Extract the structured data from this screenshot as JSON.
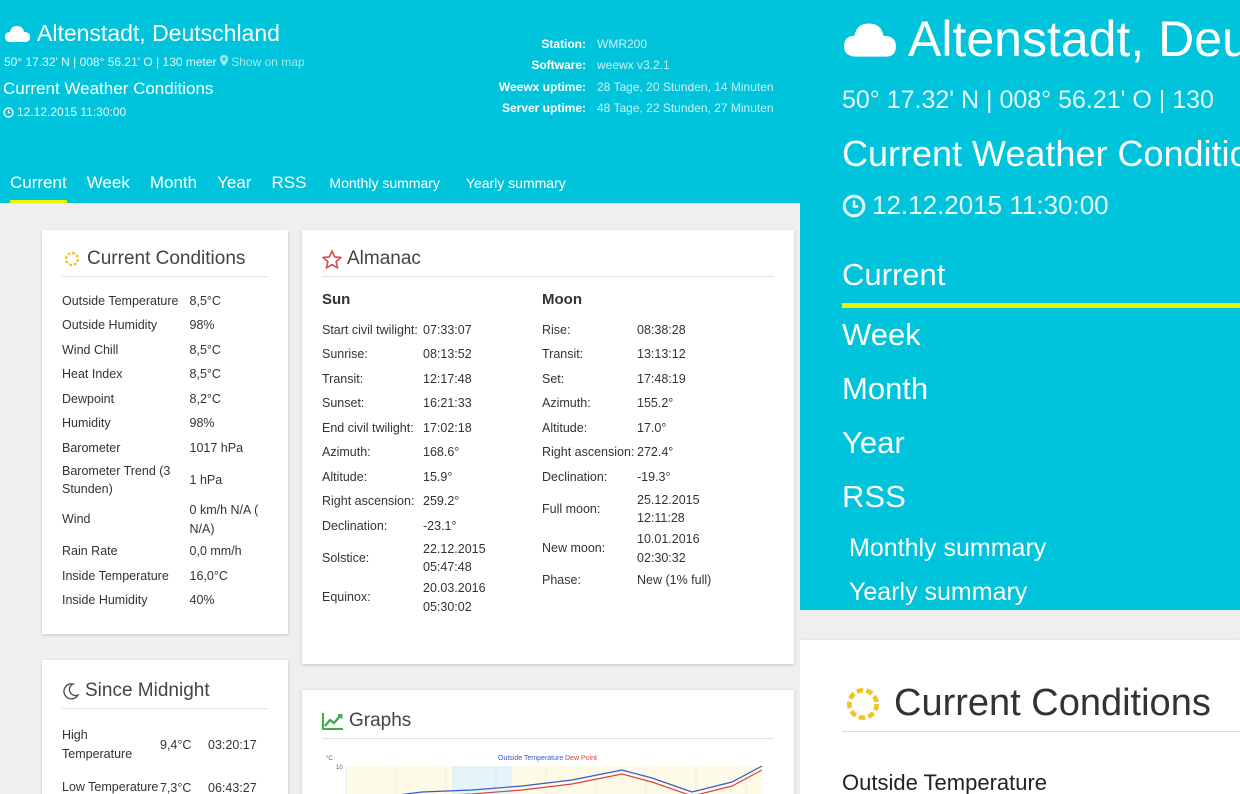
{
  "header": {
    "location": "Altenstadt, Deutschland",
    "coords": "50° 17.32' N | 008° 56.21' O | 130 meter",
    "coords_mobile": "50° 17.32' N | 008° 56.21' O | 130",
    "map_link": "Show on map",
    "subtitle": "Current Weather Conditions",
    "timestamp": "12.12.2015 11:30:00",
    "icons": {
      "cloud": "cloud-icon",
      "map": "map-marker-icon",
      "clock": "clock-icon"
    },
    "station": [
      {
        "label": "Station:",
        "value": "WMR200"
      },
      {
        "label": "Software:",
        "value": "weewx v3.2.1"
      },
      {
        "label": "Weewx uptime:",
        "value": "28 Tage, 20 Stunden, 14 Minuten"
      },
      {
        "label": "Server uptime:",
        "value": "48 Tage, 22 Stunden, 27 Minuten"
      }
    ]
  },
  "nav": {
    "current": "Current",
    "week": "Week",
    "month": "Month",
    "year": "Year",
    "rss": "RSS",
    "monthly": "Monthly summary",
    "yearly": "Yearly summary"
  },
  "current_conditions": {
    "title": "Current Conditions",
    "rows": [
      {
        "label": "Outside Temperature",
        "value": "8,5°C"
      },
      {
        "label": "Outside Humidity",
        "value": "98%"
      },
      {
        "label": "Wind Chill",
        "value": "8,5°C"
      },
      {
        "label": "Heat Index",
        "value": "8,5°C"
      },
      {
        "label": "Dewpoint",
        "value": "8,2°C"
      },
      {
        "label": "Humidity",
        "value": "98%"
      },
      {
        "label": "Barometer",
        "value": "1017 hPa"
      },
      {
        "label": "Barometer Trend (3 Stunden)",
        "value": "1 hPa"
      },
      {
        "label": "Wind",
        "value": "0 km/h N/A ( N/A)"
      },
      {
        "label": "Rain Rate",
        "value": "0,0 mm/h"
      },
      {
        "label": "Inside Temperature",
        "value": "16,0°C"
      },
      {
        "label": "Inside Humidity",
        "value": "40%"
      }
    ]
  },
  "almanac": {
    "title": "Almanac",
    "sun_heading": "Sun",
    "moon_heading": "Moon",
    "sun": [
      {
        "label": "Start civil twilight:",
        "value": "07:33:07"
      },
      {
        "label": "Sunrise:",
        "value": "08:13:52"
      },
      {
        "label": "Transit:",
        "value": "12:17:48"
      },
      {
        "label": "Sunset:",
        "value": "16:21:33"
      },
      {
        "label": "End civil twilight:",
        "value": "17:02:18"
      },
      {
        "label": "Azimuth:",
        "value": "168.6°"
      },
      {
        "label": "Altitude:",
        "value": "15.9°"
      },
      {
        "label": "Right ascension:",
        "value": "259.2°"
      },
      {
        "label": "Declination:",
        "value": "-23.1°"
      },
      {
        "label": "Solstice:",
        "value": "22.12.2015 05:47:48"
      },
      {
        "label": "Equinox:",
        "value": "20.03.2016 05:30:02"
      }
    ],
    "moon": [
      {
        "label": "Rise:",
        "value": "08:38:28"
      },
      {
        "label": "Transit:",
        "value": "13:13:12"
      },
      {
        "label": "Set:",
        "value": "17:48:19"
      },
      {
        "label": "Azimuth:",
        "value": "155.2°"
      },
      {
        "label": "Altitude:",
        "value": "17.0°"
      },
      {
        "label": "Right ascension:",
        "value": "272.4°"
      },
      {
        "label": "Declination:",
        "value": "-19.3°"
      },
      {
        "label": "Full moon:",
        "value": "25.12.2015 12:11:28"
      },
      {
        "label": "New moon:",
        "value": "10.01.2016 02:30:32"
      },
      {
        "label": "Phase:",
        "value": "New (1% full)"
      }
    ]
  },
  "since_midnight": {
    "title": "Since Midnight",
    "rows": [
      {
        "label": "High Temperature",
        "value": "9,4°C",
        "time": "03:20:17"
      },
      {
        "label": "Low Temperature",
        "value": "7,3°C",
        "time": "06:43:27"
      }
    ]
  },
  "graphs": {
    "title": "Graphs",
    "chart_title_a": "Outside Temperature",
    "chart_title_b": "Dew Point",
    "y_unit": "°C",
    "y_tick": "10"
  },
  "mobile_first_row": "Outside Temperature",
  "colors": {
    "header": "#00c4dc",
    "active_tab": "#e8f500",
    "sun_icon": "#f4c21c",
    "star_icon": "#e0474c",
    "graph_icon": "#3fae49"
  }
}
